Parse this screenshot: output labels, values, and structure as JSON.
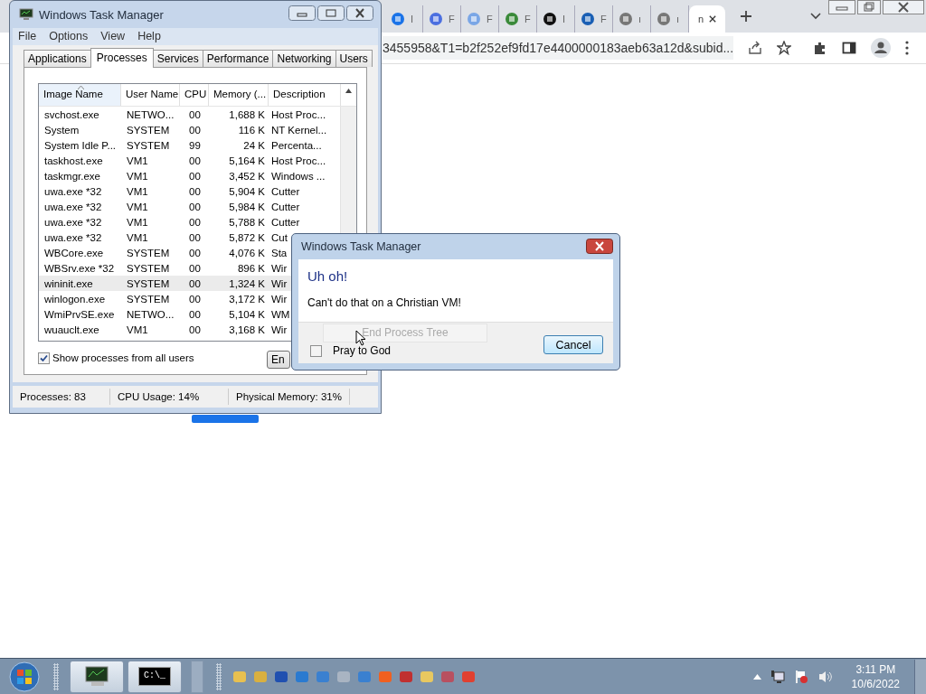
{
  "browser": {
    "tabs": [
      {
        "label": "I",
        "selected": false
      },
      {
        "label": "F",
        "selected": false
      },
      {
        "label": "F",
        "selected": false
      },
      {
        "label": "F",
        "selected": false
      },
      {
        "label": "I",
        "selected": false
      },
      {
        "label": "F",
        "selected": false
      },
      {
        "label": "ı",
        "selected": false
      },
      {
        "label": "ı",
        "selected": false
      },
      {
        "label": "n",
        "selected": true
      }
    ],
    "url": "3455958&T1=b2f252ef9fd17e4400000183aeb63a12d&subid..."
  },
  "task_manager": {
    "title": "Windows Task Manager",
    "menu": [
      "File",
      "Options",
      "View",
      "Help"
    ],
    "tabs": [
      {
        "label": "Applications",
        "selected": false
      },
      {
        "label": "Processes",
        "selected": true
      },
      {
        "label": "Services",
        "selected": false
      },
      {
        "label": "Performance",
        "selected": false
      },
      {
        "label": "Networking",
        "selected": false
      },
      {
        "label": "Users",
        "selected": false
      }
    ],
    "columns": [
      "Image Name",
      "User Name",
      "CPU",
      "Memory (...",
      "Description"
    ],
    "rows": [
      {
        "cells": [
          "svchost.exe",
          "NETWO...",
          "00",
          "1,688 K",
          "Host Proc..."
        ],
        "selected": false
      },
      {
        "cells": [
          "System",
          "SYSTEM",
          "00",
          "116 K",
          "NT Kernel..."
        ],
        "selected": false
      },
      {
        "cells": [
          "System Idle P...",
          "SYSTEM",
          "99",
          "24 K",
          "Percenta..."
        ],
        "selected": false
      },
      {
        "cells": [
          "taskhost.exe",
          "VM1",
          "00",
          "5,164 K",
          "Host Proc..."
        ],
        "selected": false
      },
      {
        "cells": [
          "taskmgr.exe",
          "VM1",
          "00",
          "3,452 K",
          "Windows ..."
        ],
        "selected": false
      },
      {
        "cells": [
          "uwa.exe *32",
          "VM1",
          "00",
          "5,904 K",
          "Cutter"
        ],
        "selected": false
      },
      {
        "cells": [
          "uwa.exe *32",
          "VM1",
          "00",
          "5,984 K",
          "Cutter"
        ],
        "selected": false
      },
      {
        "cells": [
          "uwa.exe *32",
          "VM1",
          "00",
          "5,788 K",
          "Cutter"
        ],
        "selected": false
      },
      {
        "cells": [
          "uwa.exe *32",
          "VM1",
          "00",
          "5,872 K",
          "Cut"
        ],
        "selected": false
      },
      {
        "cells": [
          "WBCore.exe",
          "SYSTEM",
          "00",
          "4,076 K",
          "Sta"
        ],
        "selected": false
      },
      {
        "cells": [
          "WBSrv.exe *32",
          "SYSTEM",
          "00",
          "896 K",
          "Wir"
        ],
        "selected": false
      },
      {
        "cells": [
          "wininit.exe",
          "SYSTEM",
          "00",
          "1,324 K",
          "Wir"
        ],
        "selected": true
      },
      {
        "cells": [
          "winlogon.exe",
          "SYSTEM",
          "00",
          "3,172 K",
          "Wir"
        ],
        "selected": false
      },
      {
        "cells": [
          "WmiPrvSE.exe",
          "NETWO...",
          "00",
          "5,104 K",
          "WM"
        ],
        "selected": false
      },
      {
        "cells": [
          "wuauclt.exe",
          "VM1",
          "00",
          "3,168 K",
          "Wir"
        ],
        "selected": false
      }
    ],
    "show_all_users": {
      "label": "Show processes from all users",
      "checked": true
    },
    "end_button": "En",
    "status": [
      "Processes: 83",
      "CPU Usage: 14%",
      "Physical Memory: 31%"
    ]
  },
  "dialog": {
    "title": "Windows Task Manager",
    "heading": "Uh oh!",
    "message": "Can't do that on a Christian VM!",
    "ghost_button": "End Process Tree",
    "checkbox": {
      "label": "Pray to God",
      "checked": false
    },
    "cancel": "Cancel"
  },
  "taskbar": {
    "console_label": "C:\\_",
    "time": "3:11 PM",
    "date": "10/6/2022"
  }
}
